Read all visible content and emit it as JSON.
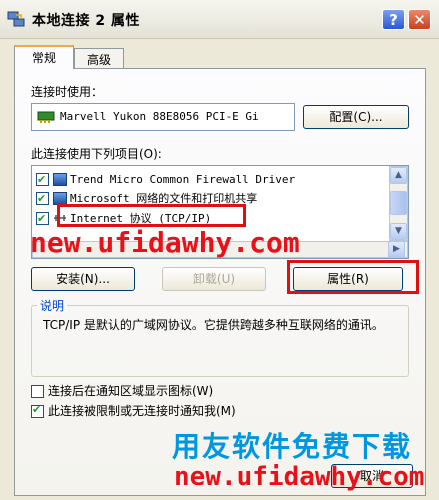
{
  "window": {
    "title": "本地连接 2 属性",
    "help_button": "?",
    "close_button": "✕"
  },
  "tabs": [
    {
      "label": "常规",
      "active": true
    },
    {
      "label": "高级",
      "active": false
    }
  ],
  "general": {
    "connect_using_label": "连接时使用：",
    "adapter_name": "Marvell Yukon 88E8056 PCI-E Gi",
    "configure_button": "配置(C)...",
    "items_label": "此连接使用下列项目(O):",
    "items": [
      {
        "label": "Trend Micro Common Firewall Driver",
        "checked": true,
        "icon": "network-client-icon"
      },
      {
        "label": "Microsoft 网络的文件和打印机共享",
        "checked": true,
        "icon": "network-share-icon"
      },
      {
        "label": "Internet 协议 (TCP/IP)",
        "checked": true,
        "icon": "protocol-icon",
        "selected": true
      }
    ],
    "install_button": "安装(N)...",
    "uninstall_button": "卸载(U)",
    "properties_button": "属性(R)",
    "description_title": "说明",
    "description_text": "TCP/IP 是默认的广域网协议。它提供跨越多种互联网络的通讯。",
    "show_icon_checkbox": {
      "label": "连接后在通知区域显示图标(W)",
      "checked": false
    },
    "notify_checkbox": {
      "label": "此连接被限制或无连接时通知我(M)",
      "checked": true
    },
    "cancel_button": "取消"
  },
  "watermarks": {
    "url_top": "new.ufidawhy.com",
    "brand_cn": "用友软件免费下载",
    "url_bottom": "new.ufidawhy.com"
  },
  "colors": {
    "highlight_red": "#e01010",
    "watermark_red": "#e8111a",
    "watermark_blue": "#0097e0"
  }
}
